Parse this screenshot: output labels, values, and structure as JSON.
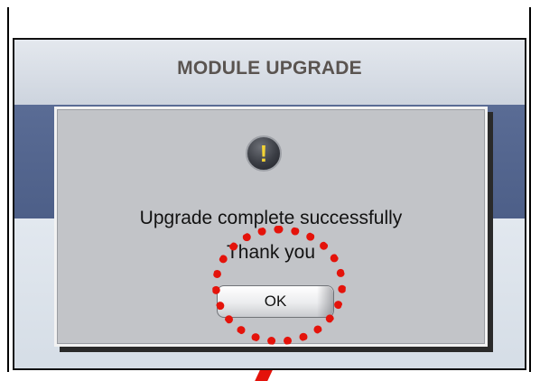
{
  "screen": {
    "title": "MODULE UPGRADE"
  },
  "dialog": {
    "icon": "warning-exclamation-icon",
    "icon_glyph": "!",
    "message_line1": "Upgrade complete successfully",
    "message_line2": "Thank you",
    "ok_label": "OK"
  },
  "annotation": {
    "color": "#e4130b",
    "shape": "dotted circle around OK button"
  }
}
